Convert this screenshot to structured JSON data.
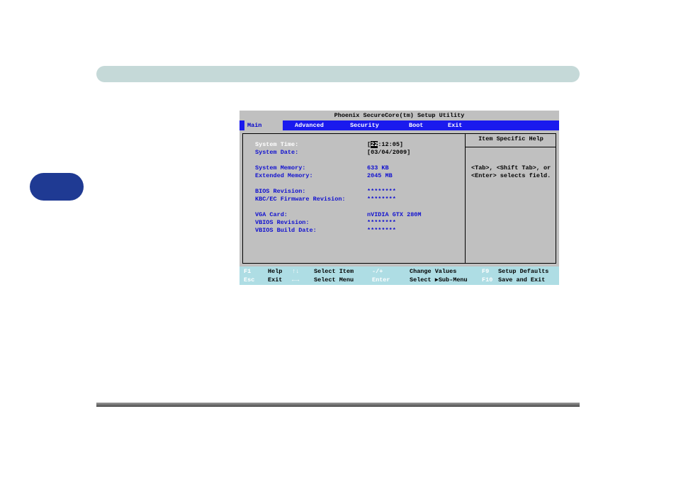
{
  "bios": {
    "title": "Phoenix SecureCore(tm) Setup Utility",
    "menu": [
      {
        "label": "Main",
        "active": true
      },
      {
        "label": "Advanced"
      },
      {
        "label": "Security"
      },
      {
        "label": "Boot"
      },
      {
        "label": "Exit"
      }
    ],
    "fields": [
      {
        "label": "System Time:",
        "value_prefix": "[",
        "value_cursor": "22",
        "value_rest": ":12:05]"
      },
      {
        "label": "System Date:",
        "value": "[03/04/2009]"
      },
      {
        "label": "System Memory:",
        "value": "633 KB"
      },
      {
        "label": "Extended Memory:",
        "value": "2045 MB"
      },
      {
        "label": "BIOS Revision:",
        "value": "********"
      },
      {
        "label": "KBC/EC Firmware Revision:",
        "value": "********"
      },
      {
        "label": "VGA Card:",
        "value": "nVIDIA GTX 280M"
      },
      {
        "label": "VBIOS Revision:",
        "value": "********"
      },
      {
        "label": "VBIOS Build Date:",
        "value": "********"
      }
    ],
    "help": {
      "title": "Item Specific Help",
      "lines": [
        "<Tab>, <Shift Tab>, or",
        "<Enter> selects field."
      ]
    },
    "statusbar": {
      "row1": [
        {
          "key": "F1",
          "label": "Help"
        },
        {
          "key": "↑↓",
          "label": "Select Item"
        },
        {
          "key": "-/+",
          "label": "Change Values"
        },
        {
          "key": "F9",
          "label": "Setup Defaults"
        }
      ],
      "row2": [
        {
          "key": "Esc",
          "label": "Exit"
        },
        {
          "key": "←→",
          "label": "Select Menu"
        },
        {
          "key": "Enter",
          "label": "Select ▶Sub-Menu"
        },
        {
          "key": "F10",
          "label": "Save and Exit"
        }
      ]
    }
  },
  "colors": {
    "header_bar": "#c5d9d8",
    "chapter_tab": "#1f3a93",
    "menubar": "#1a1aee",
    "statusbar": "#aedde4",
    "bios_bg": "#c0c0c0"
  }
}
